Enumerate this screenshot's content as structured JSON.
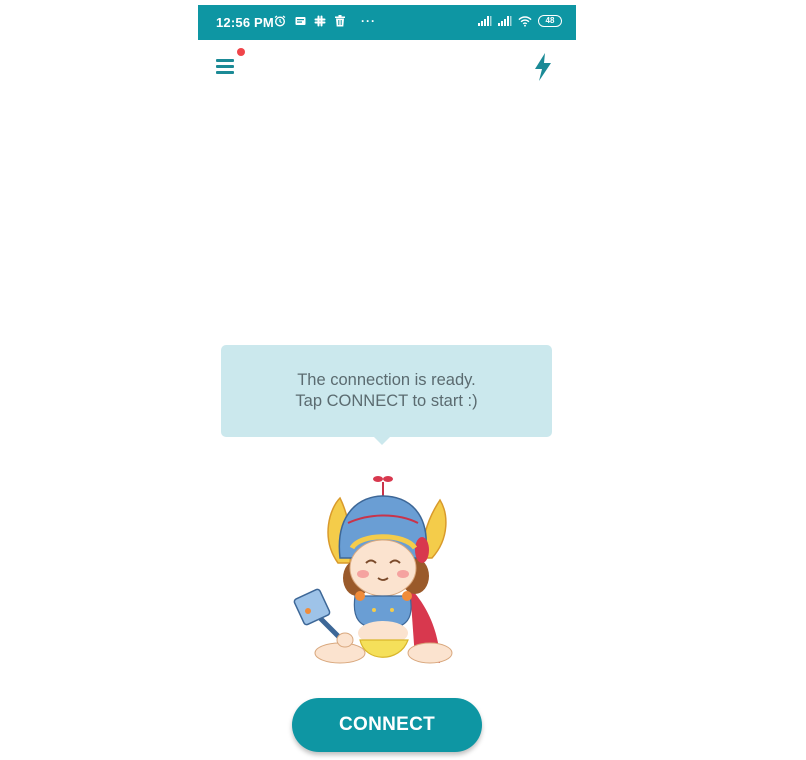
{
  "status_bar": {
    "time": "12:56 PM",
    "left_icons": [
      "alarm-icon",
      "message-icon",
      "slack-icon",
      "trash-icon"
    ],
    "more": "···",
    "right_icons": [
      "signal-icon",
      "signal-icon",
      "wifi-icon"
    ],
    "battery": "48"
  },
  "app_bar": {
    "menu_icon": "hamburger-menu-icon",
    "has_notification": true,
    "action_icon": "lightning-bolt-icon"
  },
  "message": {
    "line1": "The connection is ready.",
    "line2": "Tap CONNECT to start :)"
  },
  "mascot": "baby-thor-mascot",
  "connect_button": {
    "label": "CONNECT"
  },
  "colors": {
    "primary": "#0e96a3",
    "bubble": "#cbe8ed",
    "notification": "#f0454a"
  }
}
